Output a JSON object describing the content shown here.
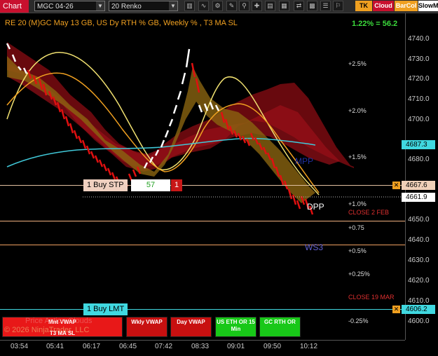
{
  "toolbar": {
    "chart_tab": "Chart",
    "instrument": "MGC 04-26",
    "bar_type": "20 Renko",
    "buttons": [
      "TK",
      "Cloud",
      "BarCol",
      "SlowM"
    ]
  },
  "plot": {
    "title": "RE 20  (M)GC May 13 GB, US Dy RTH % GB, Weekly % , T3 MA SL",
    "performance": "1.22% = 56.2"
  },
  "axis": {
    "price_ticks": [
      "4740.0",
      "4730.0",
      "4720.0",
      "4710.0",
      "4700.0",
      "4680.0",
      "4660.0",
      "4650.0",
      "4640.0",
      "4630.0",
      "4620.0",
      "4610.0",
      "4600.0"
    ],
    "price_tags": {
      "cyan": "4687.3",
      "order_stop": "4667.6",
      "current": "4661.9",
      "order_limit": "4606.2"
    },
    "pct_labels": [
      "+2.5%",
      "+2.0%",
      "+1.5%",
      "+1.0%",
      "+0.75",
      "+0.5%",
      "+0.25%",
      "-0.25%"
    ],
    "time_labels": [
      "03:54",
      "05:41",
      "06:17",
      "06:45",
      "07:42",
      "08:33",
      "09:01",
      "09:50",
      "10:12"
    ]
  },
  "annotations": {
    "mpp": "MPP",
    "dpp": "DPP",
    "ws3": "WS3",
    "close_feb": "CLOSE 2 FEB",
    "close_mar": "CLOSE 19 MAR"
  },
  "orders": {
    "stop": {
      "label": "1 Buy STP",
      "qty": "57",
      "count": "1"
    },
    "limit": {
      "label": "1 Buy LMT"
    }
  },
  "market_buttons": [
    {
      "line1": "Mnt VWAP",
      "line2": "T3 MA SL",
      "color": "#e81818"
    },
    {
      "line1": "Wkly VWAP",
      "line2": "",
      "color": "#c81010"
    },
    {
      "line1": "Day VWAP",
      "line2": "",
      "color": "#c81010"
    },
    {
      "line1": "US ETH OR 15",
      "line2": "Min",
      "color": "#18c818"
    },
    {
      "line1": "GC RTH OR",
      "line2": "",
      "color": "#18c818"
    }
  ],
  "watermark": {
    "line1": "Price Action Clouds",
    "line2": "© 2026 NinjaTrader, LLC"
  },
  "colors": {
    "price_down": "#e01010",
    "price_up": "#ffffff",
    "cloud_red": "#7a0b10",
    "cloud_gold": "#8a6410",
    "ma_yellow": "#f0e070",
    "ma_orange": "#f0a020",
    "ma_cyan": "#40c8d8"
  }
}
